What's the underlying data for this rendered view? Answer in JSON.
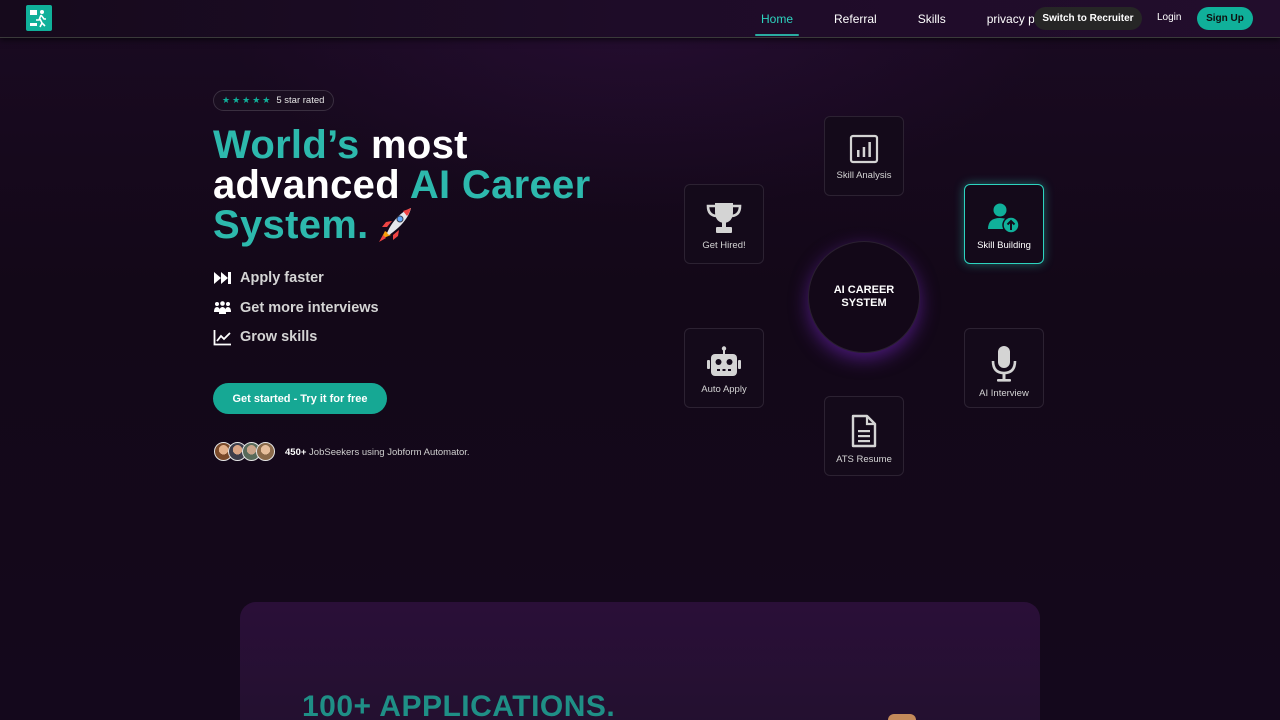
{
  "nav": {
    "links": [
      {
        "label": "Home",
        "active": true
      },
      {
        "label": "Referral",
        "active": false
      },
      {
        "label": "Skills",
        "active": false
      },
      {
        "label": "privacy policy",
        "active": false
      }
    ],
    "recruiter_label": "Switch to Recruiter",
    "login_label": "Login",
    "signup_label": "Sign Up"
  },
  "hero": {
    "rating_text": "5 star rated",
    "stars": 5,
    "headline": {
      "part1": "World’s",
      "part2": " most",
      "part3": "advanced ",
      "part4": "AI Career",
      "part5": "System."
    },
    "features": [
      {
        "icon": "fast-forward-icon",
        "label": "Apply faster"
      },
      {
        "icon": "people-group-icon",
        "label": "Get more interviews"
      },
      {
        "icon": "chart-line-icon",
        "label": "Grow skills"
      }
    ],
    "cta_label": "Get started - Try it for free",
    "users_count": "450+",
    "users_text": " JobSeekers using Jobform Automator."
  },
  "diagram": {
    "hub_label": "AI CAREER SYSTEM",
    "tiles": [
      {
        "label": "Skill Analysis",
        "icon": "bar-chart-icon"
      },
      {
        "label": "Get Hired!",
        "icon": "trophy-icon"
      },
      {
        "label": "Skill Building",
        "icon": "user-upgrade-icon",
        "active": true
      },
      {
        "label": "Auto Apply",
        "icon": "robot-icon"
      },
      {
        "label": "AI Interview",
        "icon": "microphone-icon"
      },
      {
        "label": "ATS Resume",
        "icon": "document-icon"
      }
    ]
  },
  "promo": {
    "title": "100+ APPLICATIONS."
  },
  "colors": {
    "accent": "#2dd4bf",
    "button": "#10b09a",
    "background": "#130818"
  }
}
